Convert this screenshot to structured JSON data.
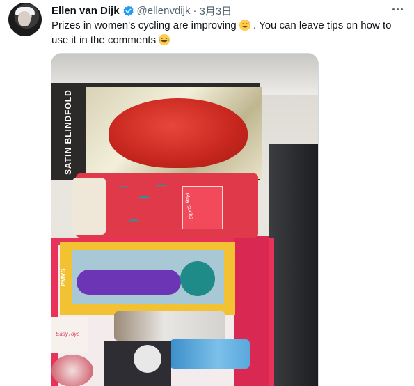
{
  "tweet": {
    "author_name": "Ellen van Dijk",
    "handle": "@ellenvdijk",
    "separator": "·",
    "date": "3月3日",
    "text_part1": "Prizes in women’s cycling are improving ",
    "text_part2": ". You can leave tips on how to use it in the comments",
    "emoji1": "sweat-smile-emoji",
    "emoji2": "tears-of-joy-emoji"
  },
  "media": {
    "blindfold_label": "SATIN BLINDFOLD",
    "socks_tag": "Play socks",
    "vibe_box_label": "PMVS",
    "small_box_label": "EasyToys"
  },
  "colors": {
    "text_primary": "#0f1419",
    "text_secondary": "#536471",
    "verified_blue": "#1d9bf0",
    "border": "#cfd9de"
  }
}
